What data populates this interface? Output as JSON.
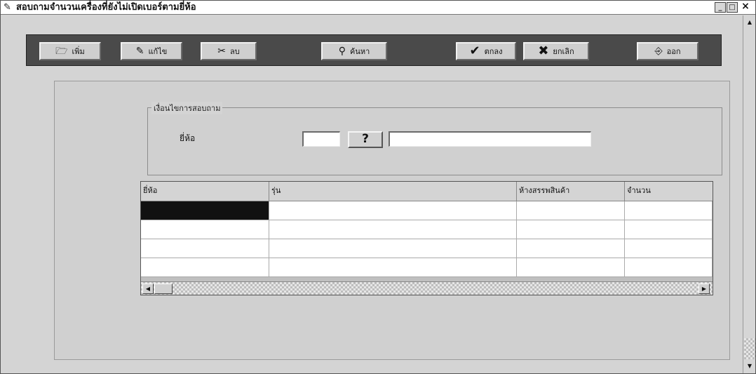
{
  "window": {
    "title": "สอบถามจำนวนเครื่องที่ยังไม่เปิดเบอร์ตามยี่ห้อ",
    "controls": {
      "minimize": "_",
      "maximize": "□",
      "close": "×"
    }
  },
  "toolbar": {
    "add_label": "เพิ่ม",
    "edit_label": "แก้ไข",
    "delete_label": "ลบ",
    "search_label": "ค้นหา",
    "ok_label": "ตกลง",
    "cancel_label": "ยกเลิก",
    "exit_label": "ออก"
  },
  "criteria": {
    "group_title": "เงื่อนไขการสอบถาม",
    "brand_label": "ยี่ห้อ",
    "brand_code_value": "",
    "lookup_button_label": "?",
    "brand_name_value": ""
  },
  "grid": {
    "columns": [
      "ยี่ห้อ",
      "รุ่น",
      "ห้างสรรพสินค้า",
      "จำนวน"
    ],
    "rows": [
      [
        "",
        "",
        "",
        ""
      ],
      [
        "",
        "",
        "",
        ""
      ],
      [
        "",
        "",
        "",
        ""
      ],
      [
        "",
        "",
        "",
        ""
      ]
    ],
    "scroll_left": "◀",
    "scroll_right": "▶"
  },
  "scrollbar": {
    "up": "▲",
    "down": "▼"
  }
}
